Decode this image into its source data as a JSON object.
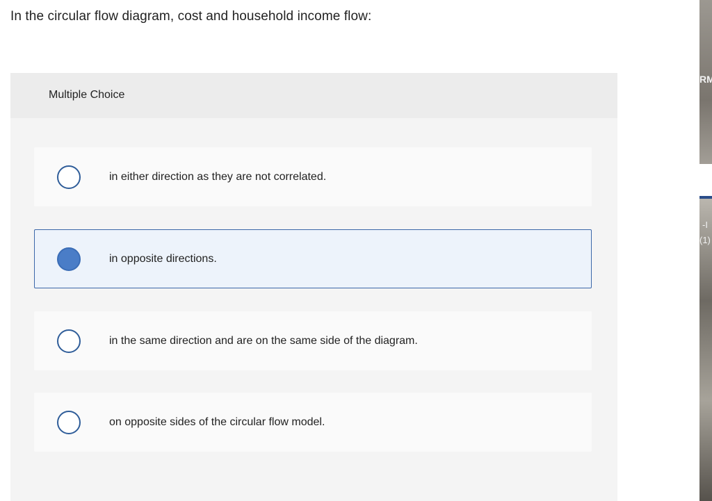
{
  "question": {
    "text": "In the circular flow diagram, cost and household income flow:"
  },
  "panel": {
    "title": "Multiple Choice"
  },
  "options": [
    {
      "label": "in either direction as they are not correlated.",
      "selected": false
    },
    {
      "label": "in opposite directions.",
      "selected": true
    },
    {
      "label": "in the same direction and are on the same side of the diagram.",
      "selected": false
    },
    {
      "label": "on opposite sides of the circular flow model.",
      "selected": false
    }
  ],
  "side_strip": {
    "text_top": "RM",
    "text_mid": "-I",
    "text_low": "(1)"
  },
  "colors": {
    "accent": "#3a66a8",
    "selected_fill": "#4a7dc7",
    "selected_bg": "#edf3fb",
    "panel_bg": "#f4f4f4",
    "header_bg": "#ececec"
  }
}
